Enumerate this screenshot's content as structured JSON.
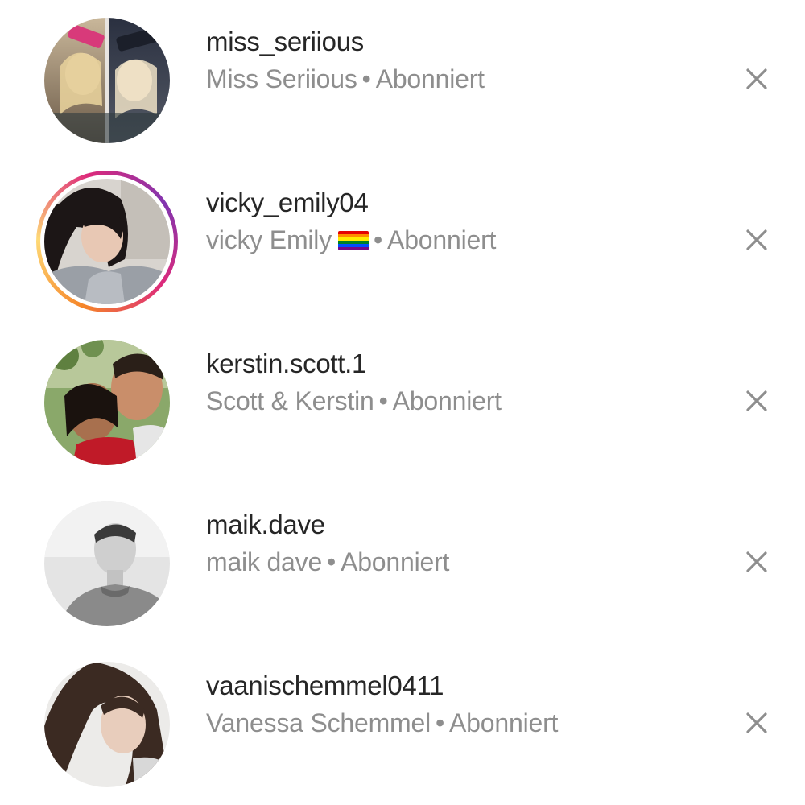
{
  "suggestions": [
    {
      "username": "miss_seriious",
      "display_name": "Miss Seriious",
      "status": "Abonniert",
      "has_story": false,
      "avatar_icon": "avatar-photo-two-women-collage"
    },
    {
      "username": "vicky_emily04",
      "display_name": "vicky Emily",
      "flag_icon": "rainbow-flag-emoji",
      "status": "Abonniert",
      "has_story": true,
      "avatar_icon": "avatar-photo-dark-haired-woman"
    },
    {
      "username": "kerstin.scott.1",
      "display_name": "Scott & Kerstin",
      "status": "Abonniert",
      "has_story": false,
      "avatar_icon": "avatar-photo-couple-kissing"
    },
    {
      "username": "maik.dave",
      "display_name": "maik dave",
      "status": "Abonniert",
      "has_story": false,
      "avatar_icon": "avatar-photo-young-man-bw"
    },
    {
      "username": "vaanischemmel0411",
      "display_name": "Vanessa Schemmel",
      "status": "Abonniert",
      "has_story": false,
      "avatar_icon": "avatar-photo-young-woman"
    }
  ],
  "separator": "•",
  "dismiss_icon": "close-icon",
  "colors": {
    "username": "#262626",
    "secondary_text": "#8e8e8e",
    "dismiss_icon": "#8e8e8e",
    "story_ring_start": "#f58529",
    "story_ring_end": "#dd2a7b"
  }
}
